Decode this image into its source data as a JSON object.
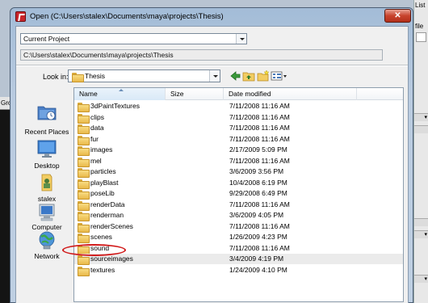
{
  "background": {
    "left_panel_label": "Gro",
    "right_panel_title": "List",
    "right_panel_label": "file"
  },
  "dialog": {
    "title": "Open (C:\\Users\\stalex\\Documents\\maya\\projects\\Thesis)",
    "close_glyph": "✕",
    "project_select": "Current Project",
    "path": "C:\\Users\\stalex\\Documents\\maya\\projects\\Thesis",
    "look_in_label": "Look in:",
    "look_in_value": "Thesis",
    "toolbar": {
      "back_icon": "back-arrow-icon",
      "up_icon": "up-folder-icon",
      "new_folder_icon": "new-folder-icon",
      "views_icon": "views-menu-icon"
    },
    "places": [
      {
        "label": "Recent Places",
        "icon": "recent-places-icon"
      },
      {
        "label": "Desktop",
        "icon": "desktop-icon"
      },
      {
        "label": "stalex",
        "icon": "user-folder-icon"
      },
      {
        "label": "Computer",
        "icon": "computer-icon"
      },
      {
        "label": "Network",
        "icon": "network-icon"
      }
    ],
    "columns": {
      "name": "Name",
      "size": "Size",
      "date": "Date modified"
    },
    "files": [
      {
        "name": "3dPaintTextures",
        "date": "7/11/2008 11:16 AM"
      },
      {
        "name": "clips",
        "date": "7/11/2008 11:16 AM"
      },
      {
        "name": "data",
        "date": "7/11/2008 11:16 AM"
      },
      {
        "name": "fur",
        "date": "7/11/2008 11:16 AM"
      },
      {
        "name": "images",
        "date": "2/17/2009 5:09 PM"
      },
      {
        "name": "mel",
        "date": "7/11/2008 11:16 AM"
      },
      {
        "name": "particles",
        "date": "3/6/2009 3:56 PM"
      },
      {
        "name": "playBlast",
        "date": "10/4/2008 6:19 PM"
      },
      {
        "name": "poseLib",
        "date": "9/29/2008 6:49 PM"
      },
      {
        "name": "renderData",
        "date": "7/11/2008 11:16 AM"
      },
      {
        "name": "renderman",
        "date": "3/6/2009 4:05 PM"
      },
      {
        "name": "renderScenes",
        "date": "7/11/2008 11:16 AM"
      },
      {
        "name": "scenes",
        "date": "1/26/2009 4:23 PM"
      },
      {
        "name": "sound",
        "date": "7/11/2008 11:16 AM"
      },
      {
        "name": "sourceimages",
        "date": "3/4/2009 4:19 PM"
      },
      {
        "name": "textures",
        "date": "1/24/2009 4:10 PM"
      }
    ],
    "highlighted_row": "sourceimages",
    "colors": {
      "annotation_circle": "#d11a1a",
      "folder": "#f0c65a",
      "close_button": "#c8432d"
    }
  }
}
